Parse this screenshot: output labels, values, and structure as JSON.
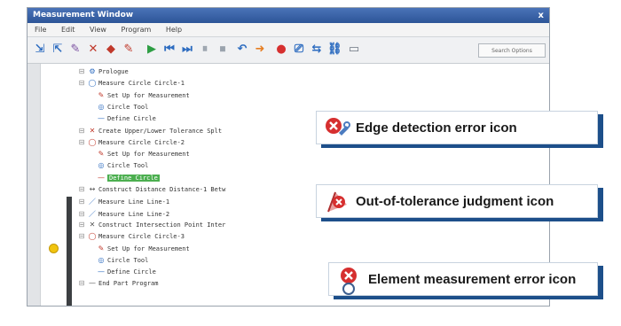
{
  "window": {
    "title": "Measurement Window",
    "close_glyph": "x"
  },
  "menu": [
    "File",
    "Edit",
    "View",
    "Program",
    "Help"
  ],
  "toolbar": {
    "search_label": "Search Options"
  },
  "tree": {
    "rows": [
      {
        "indent": 1,
        "icon": "settings-icon",
        "glyph": "⚙",
        "color": "#2d6cc0",
        "label": "Prologue"
      },
      {
        "indent": 1,
        "icon": "circle-icon",
        "glyph": "◯",
        "color": "#2d6cc0",
        "label": "Measure Circle Circle-1"
      },
      {
        "indent": 2,
        "icon": "measure-setup-icon",
        "glyph": "✎",
        "color": "#c0392b",
        "label": "Set Up for Measurement"
      },
      {
        "indent": 2,
        "icon": "circle-tool-icon",
        "glyph": "◎",
        "color": "#2d6cc0",
        "label": "Circle Tool"
      },
      {
        "indent": 2,
        "icon": "define-icon",
        "glyph": "—",
        "color": "#2d6cc0",
        "label": "Define Circle"
      },
      {
        "indent": 1,
        "icon": "tolerance-icon",
        "glyph": "✕",
        "color": "#c0392b",
        "label": "Create Upper/Lower Tolerance Splt"
      },
      {
        "indent": 1,
        "icon": "circle-icon",
        "glyph": "◯",
        "color": "#c0392b",
        "label": "Measure Circle Circle-2"
      },
      {
        "indent": 2,
        "icon": "measure-setup-icon",
        "glyph": "✎",
        "color": "#c0392b",
        "label": "Set Up for Measurement"
      },
      {
        "indent": 2,
        "icon": "circle-tool-icon",
        "glyph": "◎",
        "color": "#2d6cc0",
        "label": "Circle Tool"
      },
      {
        "indent": 2,
        "icon": "define-icon",
        "glyph": "—",
        "color": "#c0392b",
        "label": "Define Circle",
        "selected": true
      },
      {
        "indent": 1,
        "icon": "construct-icon",
        "glyph": "↔",
        "color": "#555555",
        "label": "Construct Distance Distance-1 Betw"
      },
      {
        "indent": 1,
        "icon": "line-icon",
        "glyph": "／",
        "color": "#2d6cc0",
        "label": "Measure Line Line-1"
      },
      {
        "indent": 1,
        "icon": "line-icon",
        "glyph": "／",
        "color": "#2d6cc0",
        "label": "Measure Line Line-2"
      },
      {
        "indent": 1,
        "icon": "construct-icon",
        "glyph": "✕",
        "color": "#555555",
        "label": "Construct Intersection Point Inter"
      },
      {
        "indent": 1,
        "icon": "circle-icon",
        "glyph": "◯",
        "color": "#c0392b",
        "label": "Measure Circle Circle-3"
      },
      {
        "indent": 2,
        "icon": "measure-setup-icon",
        "glyph": "✎",
        "color": "#c0392b",
        "label": "Set Up for Measurement"
      },
      {
        "indent": 2,
        "icon": "circle-tool-icon",
        "glyph": "◎",
        "color": "#2d6cc0",
        "label": "Circle Tool"
      },
      {
        "indent": 2,
        "icon": "define-icon",
        "glyph": "—",
        "color": "#2d6cc0",
        "label": "Define Circle"
      },
      {
        "indent": 1,
        "icon": "end-icon",
        "glyph": "—",
        "color": "#555555",
        "label": "End Part Program"
      }
    ]
  },
  "callouts": [
    {
      "label": "Edge detection error icon",
      "icon": "edge-detection-error-icon"
    },
    {
      "label": "Out-of-tolerance judgment icon",
      "icon": "out-of-tolerance-icon"
    },
    {
      "label": "Element measurement error icon",
      "icon": "element-measurement-error-icon"
    }
  ],
  "colors": {
    "accent": "#1d4f8a",
    "error": "#d62f2f",
    "selection": "#4caf50",
    "marker": "#f1c40f"
  }
}
